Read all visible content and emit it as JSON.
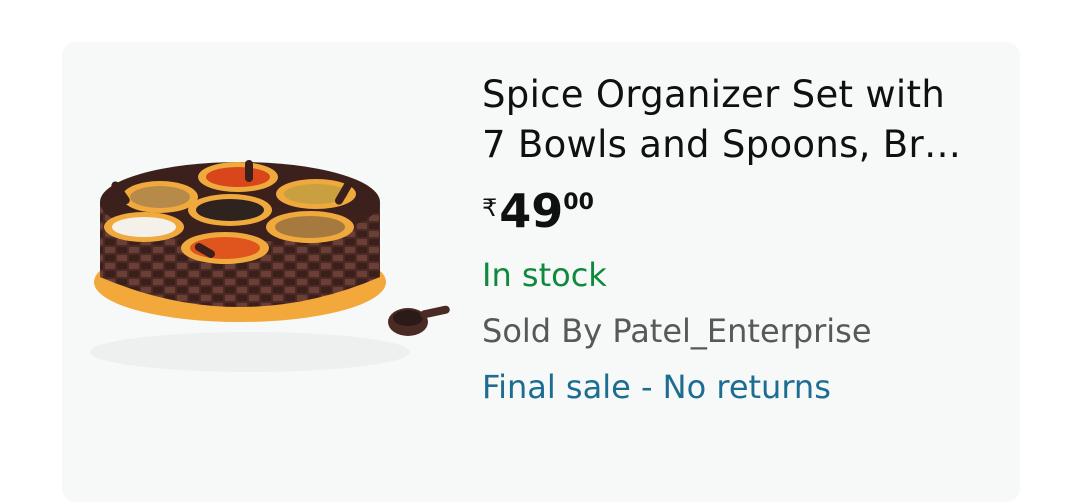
{
  "product": {
    "title_line1": "Spice Organizer Set with",
    "title_line2": "7 Bowls and Spoons, Br…",
    "price_symbol": "₹",
    "price_whole": "49",
    "price_fraction": "00",
    "availability": "In stock",
    "seller": "Sold By Patel_Enterprise",
    "return_policy": "Final sale - No returns",
    "image_icon": "spice-organizer-product-image"
  },
  "colors": {
    "availability": "#0f8a3c",
    "seller": "#565959",
    "return_policy": "#1c6d91",
    "card_bg": "#f7f8f8"
  }
}
